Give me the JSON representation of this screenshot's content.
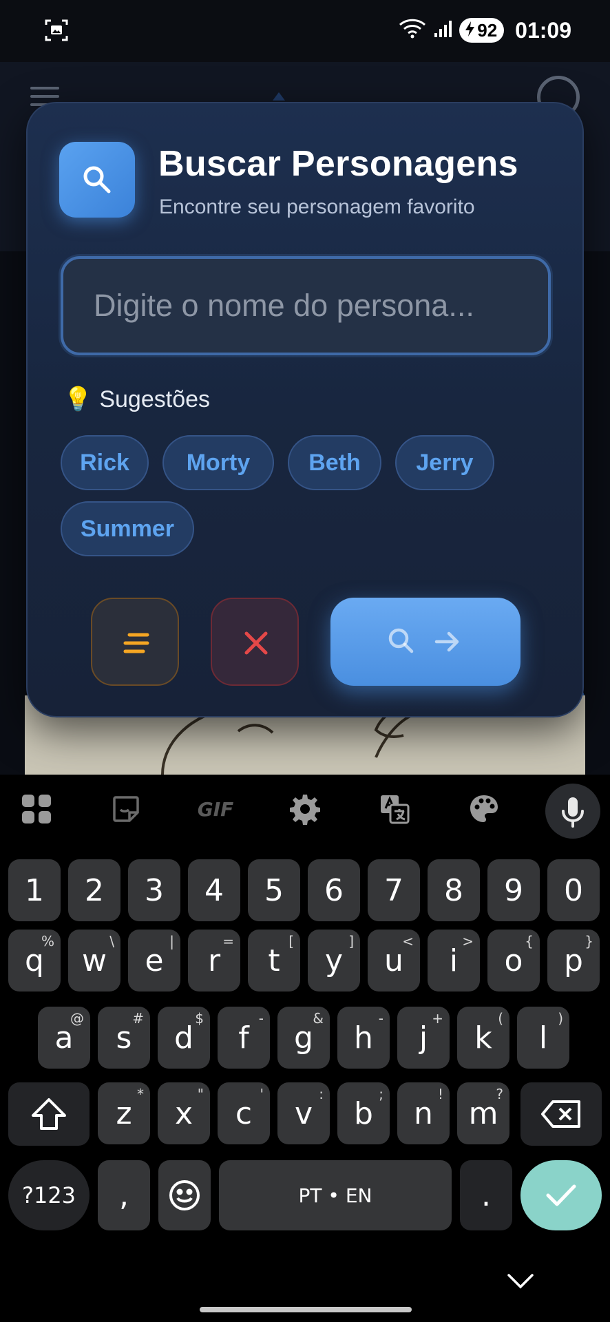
{
  "status_bar": {
    "battery": "92",
    "time": "01:09"
  },
  "search_modal": {
    "title": "Buscar Personagens",
    "subtitle": "Encontre seu personagem favorito",
    "input_placeholder": "Digite o nome do persona...",
    "input_value": "",
    "suggestions_label": "Sugestões",
    "suggestions_emoji": "💡",
    "suggestions": [
      "Rick",
      "Morty",
      "Beth",
      "Jerry",
      "Summer"
    ],
    "accent_color": "#4a90e2",
    "sort_button_color": "#f5a623",
    "clear_button_color": "#e54848",
    "buttons": {
      "sort_icon": "sort-lines-icon",
      "clear_icon": "close-icon",
      "search_icon": "search-icon",
      "arrow_icon": "arrow-right-icon"
    }
  },
  "keyboard": {
    "toolbar": [
      "apps-grid-icon",
      "sticker-icon",
      "GIF",
      "gear-icon",
      "translate-icon",
      "palette-icon",
      "microphone-icon"
    ],
    "number_row": [
      "1",
      "2",
      "3",
      "4",
      "5",
      "6",
      "7",
      "8",
      "9",
      "0"
    ],
    "row1": [
      {
        "key": "q",
        "alt": "%"
      },
      {
        "key": "w",
        "alt": "\\"
      },
      {
        "key": "e",
        "alt": "|"
      },
      {
        "key": "r",
        "alt": "="
      },
      {
        "key": "t",
        "alt": "["
      },
      {
        "key": "y",
        "alt": "]"
      },
      {
        "key": "u",
        "alt": "<"
      },
      {
        "key": "i",
        "alt": ">"
      },
      {
        "key": "o",
        "alt": "{"
      },
      {
        "key": "p",
        "alt": "}"
      }
    ],
    "row2": [
      {
        "key": "a",
        "alt": "@"
      },
      {
        "key": "s",
        "alt": "#"
      },
      {
        "key": "d",
        "alt": "$"
      },
      {
        "key": "f",
        "alt": "-"
      },
      {
        "key": "g",
        "alt": "&"
      },
      {
        "key": "h",
        "alt": "-"
      },
      {
        "key": "j",
        "alt": "+"
      },
      {
        "key": "k",
        "alt": "("
      },
      {
        "key": "l",
        "alt": ")"
      }
    ],
    "row3": [
      {
        "key": "z",
        "alt": "*"
      },
      {
        "key": "x",
        "alt": "\""
      },
      {
        "key": "c",
        "alt": "'"
      },
      {
        "key": "v",
        "alt": ":"
      },
      {
        "key": "b",
        "alt": ";"
      },
      {
        "key": "n",
        "alt": "!"
      },
      {
        "key": "m",
        "alt": "?"
      }
    ],
    "symbols_key": "?123",
    "comma_key": ",",
    "space_label": "PT • EN",
    "period_key": ".",
    "enter_color": "#8ad3c9"
  }
}
